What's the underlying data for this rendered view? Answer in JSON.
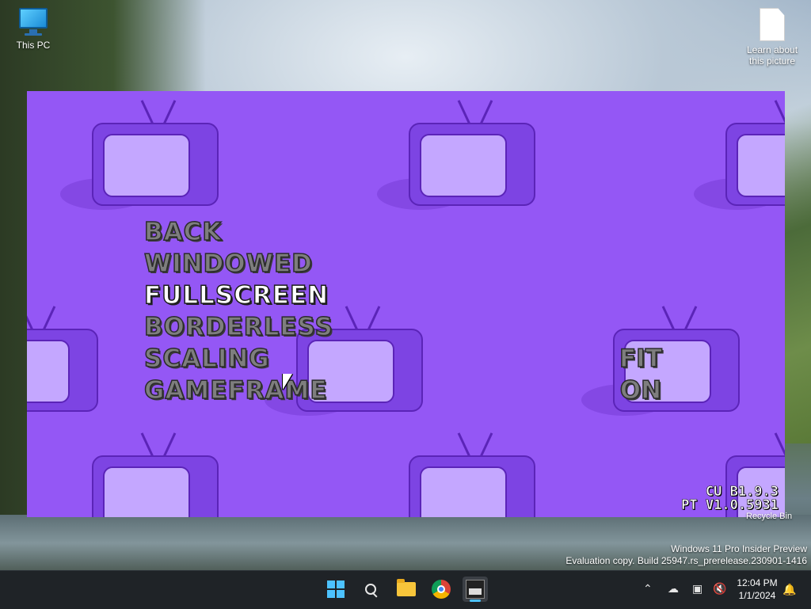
{
  "desktop": {
    "icons": [
      {
        "label": "This PC"
      },
      {
        "label": "Learn about this picture"
      }
    ],
    "recycle_bin_label": "Recycle Bin",
    "watermark": {
      "line1": "Windows 11 Pro Insider Preview",
      "line2": "Evaluation copy. Build 25947.rs_prerelease.230901-1416"
    }
  },
  "game": {
    "menu": [
      {
        "label": "BACK",
        "selected": false
      },
      {
        "label": "WINDOWED",
        "selected": false
      },
      {
        "label": "FULLSCREEN",
        "selected": true
      },
      {
        "label": "BORDERLESS",
        "selected": false
      },
      {
        "label": "SCALING",
        "selected": false
      },
      {
        "label": "GAMEFRAME",
        "selected": false
      }
    ],
    "values": {
      "scaling": "FIT",
      "gameframe": "ON"
    },
    "version": {
      "line1": "CU B1.9.3",
      "line2": "PT V1.0.5931"
    },
    "background_color": "#9457f5"
  },
  "taskbar": {
    "apps": [
      "start-icon",
      "search-icon",
      "file-explorer-icon",
      "chrome-icon",
      "game-app-icon"
    ],
    "clock": {
      "time": "12:04 PM",
      "date": "1/1/2024"
    },
    "tray": [
      "chevron-up-icon",
      "cloud-off-icon",
      "network-icon",
      "volume-muted-icon",
      "notification-bell-icon"
    ],
    "accent_color": "#4cc2ff"
  }
}
